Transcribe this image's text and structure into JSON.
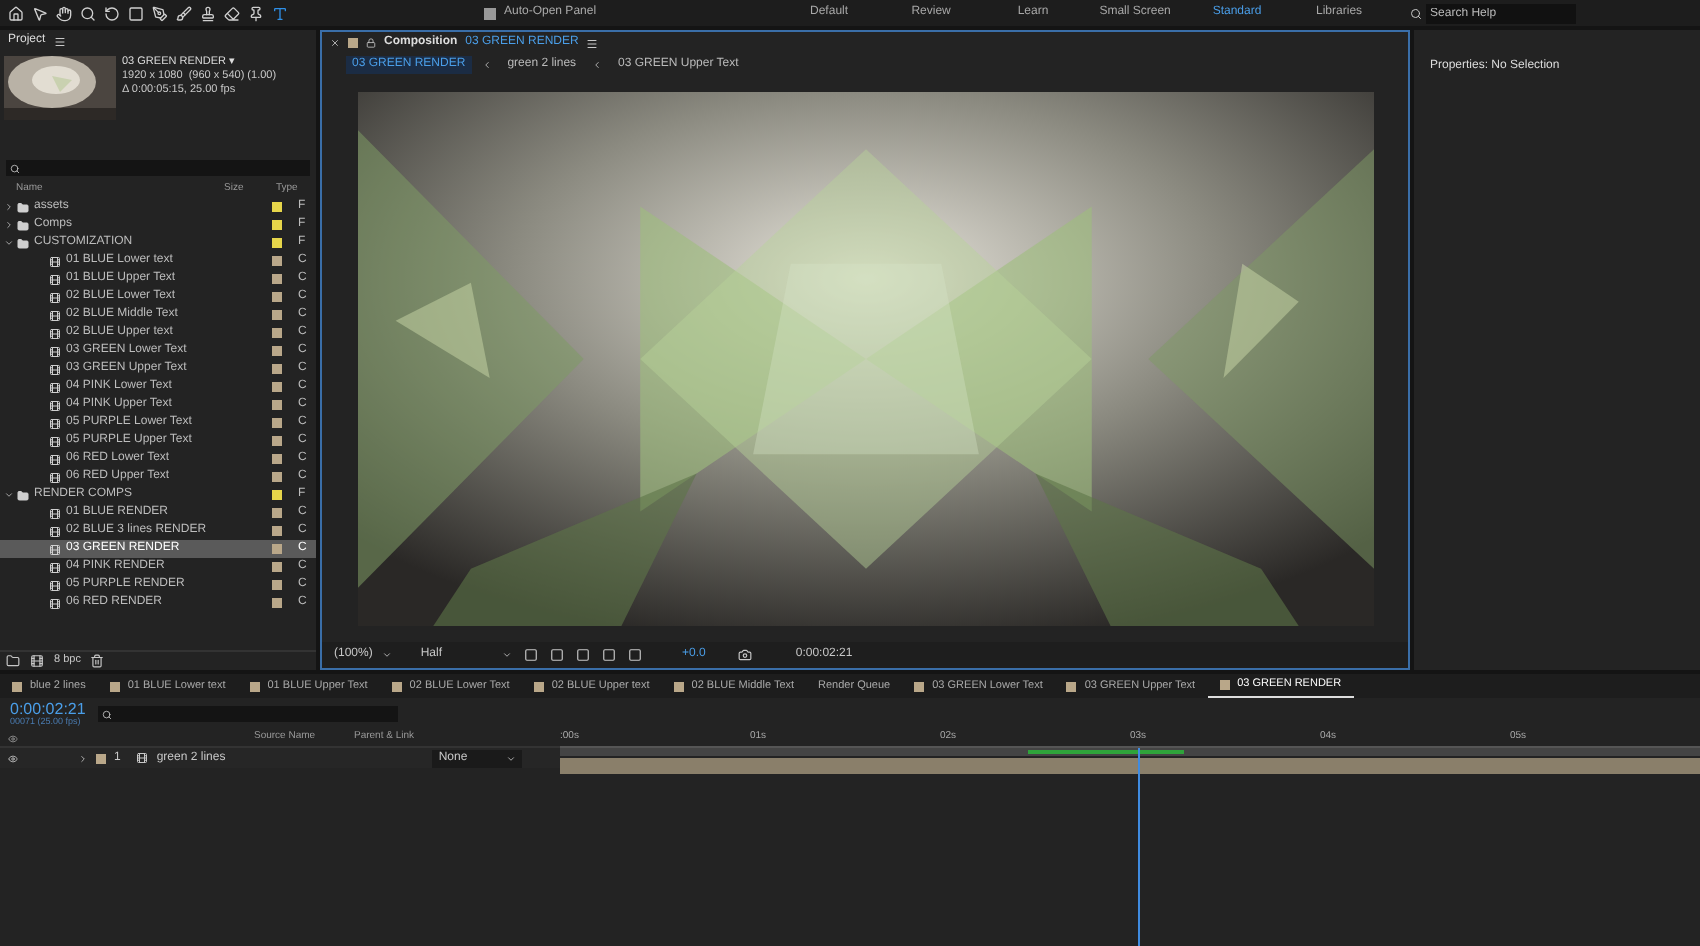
{
  "toolbar": {
    "auto_open_panel": {
      "label": "Auto-Open Panel",
      "checked": true
    }
  },
  "workspaces": [
    {
      "label": "Default",
      "selected": false
    },
    {
      "label": "Review",
      "selected": false
    },
    {
      "label": "Learn",
      "selected": false
    },
    {
      "label": "Small Screen",
      "selected": false
    },
    {
      "label": "Standard",
      "selected": true
    },
    {
      "label": "Libraries",
      "selected": false
    }
  ],
  "search_help": {
    "placeholder": "Search Help"
  },
  "project": {
    "title": "Project",
    "comp_name": "03 GREEN RENDER ▾",
    "comp_size": "1920 x 1080  (960 x 540) (1.00)",
    "comp_duration": "Δ 0:00:05:15, 25.00 fps",
    "columns": [
      "Name",
      "Size",
      "Type"
    ],
    "bpc": "8 bpc",
    "items": [
      {
        "kind": "folder",
        "name": "assets",
        "type": "F",
        "color": "#e6d54a",
        "expanded": false,
        "selected": false
      },
      {
        "kind": "folder",
        "name": "Comps",
        "type": "F",
        "color": "#e6d54a",
        "expanded": false,
        "selected": false
      },
      {
        "kind": "folder",
        "name": "CUSTOMIZATION",
        "type": "F",
        "color": "#e6d54a",
        "expanded": true,
        "selected": false,
        "children": [
          {
            "kind": "comp",
            "name": "01 BLUE Lower text",
            "type": "C",
            "color": "#b9a789",
            "selected": false
          },
          {
            "kind": "comp",
            "name": "01 BLUE Upper Text",
            "type": "C",
            "color": "#b9a789",
            "selected": false
          },
          {
            "kind": "comp",
            "name": "02 BLUE Lower Text",
            "type": "C",
            "color": "#b9a789",
            "selected": false
          },
          {
            "kind": "comp",
            "name": "02 BLUE Middle Text",
            "type": "C",
            "color": "#b9a789",
            "selected": false
          },
          {
            "kind": "comp",
            "name": "02 BLUE Upper text",
            "type": "C",
            "color": "#b9a789",
            "selected": false
          },
          {
            "kind": "comp",
            "name": "03 GREEN Lower Text",
            "type": "C",
            "color": "#b9a789",
            "selected": false
          },
          {
            "kind": "comp",
            "name": "03 GREEN Upper Text",
            "type": "C",
            "color": "#b9a789",
            "selected": false
          },
          {
            "kind": "comp",
            "name": "04 PINK Lower Text",
            "type": "C",
            "color": "#b9a789",
            "selected": false
          },
          {
            "kind": "comp",
            "name": "04 PINK Upper Text",
            "type": "C",
            "color": "#b9a789",
            "selected": false
          },
          {
            "kind": "comp",
            "name": "05 PURPLE Lower Text",
            "type": "C",
            "color": "#b9a789",
            "selected": false
          },
          {
            "kind": "comp",
            "name": "05 PURPLE Upper Text",
            "type": "C",
            "color": "#b9a789",
            "selected": false
          },
          {
            "kind": "comp",
            "name": "06 RED Lower Text",
            "type": "C",
            "color": "#b9a789",
            "selected": false
          },
          {
            "kind": "comp",
            "name": "06 RED Upper Text",
            "type": "C",
            "color": "#b9a789",
            "selected": false
          }
        ]
      },
      {
        "kind": "folder",
        "name": "RENDER COMPS",
        "type": "F",
        "color": "#e6d54a",
        "expanded": true,
        "selected": false,
        "children": [
          {
            "kind": "comp",
            "name": "01 BLUE RENDER",
            "type": "C",
            "color": "#b9a789",
            "selected": false
          },
          {
            "kind": "comp",
            "name": "02 BLUE 3 lines RENDER",
            "type": "C",
            "color": "#b9a789",
            "selected": false
          },
          {
            "kind": "comp",
            "name": "03 GREEN RENDER",
            "type": "C",
            "color": "#b9a789",
            "selected": true
          },
          {
            "kind": "comp",
            "name": "04 PINK RENDER",
            "type": "C",
            "color": "#b9a789",
            "selected": false
          },
          {
            "kind": "comp",
            "name": "05 PURPLE RENDER",
            "type": "C",
            "color": "#b9a789",
            "selected": false
          },
          {
            "kind": "comp",
            "name": "06 RED RENDER",
            "type": "C",
            "color": "#b9a789",
            "selected": false
          }
        ]
      }
    ]
  },
  "composition": {
    "title": "Composition",
    "comp_name": "03 GREEN RENDER",
    "breadcrumbs": [
      {
        "label": "03 GREEN RENDER",
        "selected": true
      },
      {
        "label": "green 2 lines",
        "selected": false
      },
      {
        "label": "03 GREEN Upper Text",
        "selected": false
      }
    ],
    "zoom": "(100%)",
    "resolution": "Half",
    "exposure": "+0.0",
    "timecode": "0:00:02:21"
  },
  "properties": {
    "title": "Properties: No Selection"
  },
  "timeline": {
    "tabs": [
      {
        "kind": "comp",
        "label": "blue 2 lines",
        "selected": false
      },
      {
        "kind": "comp",
        "label": "01 BLUE Lower text",
        "selected": false
      },
      {
        "kind": "comp",
        "label": "01 BLUE Upper Text",
        "selected": false
      },
      {
        "kind": "comp",
        "label": "02 BLUE Lower Text",
        "selected": false
      },
      {
        "kind": "comp",
        "label": "02 BLUE Upper text",
        "selected": false
      },
      {
        "kind": "comp",
        "label": "02 BLUE Middle Text",
        "selected": false
      },
      {
        "kind": "queue",
        "label": "Render Queue",
        "selected": false
      },
      {
        "kind": "comp",
        "label": "03 GREEN Lower Text",
        "selected": false
      },
      {
        "kind": "comp",
        "label": "03 GREEN Upper Text",
        "selected": false
      },
      {
        "kind": "comp",
        "label": "03 GREEN RENDER",
        "selected": true
      }
    ],
    "timecode": "0:00:02:21",
    "frames": "00071 (25.00 fps)",
    "columns": [
      "Source Name",
      "Parent & Link"
    ],
    "ticks": [
      ":00s",
      "01s",
      "02s",
      "03s",
      "04s",
      "05s"
    ],
    "playhead": {
      "level": 0.507
    },
    "layers": [
      {
        "number": "1",
        "name": "green 2 lines",
        "parent": "None",
        "color": "#b9a789"
      }
    ]
  }
}
